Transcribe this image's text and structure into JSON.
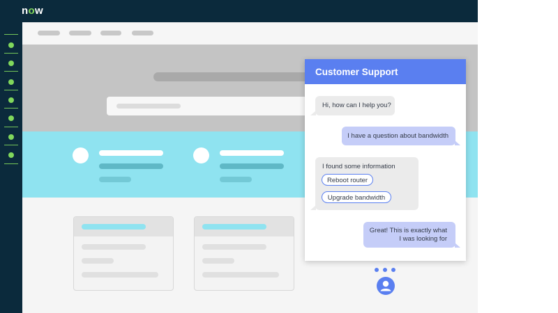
{
  "brand": {
    "logo_text_before": "n",
    "logo_text_o": "o",
    "logo_text_after": "w"
  },
  "colors": {
    "nav_bg": "#0b2a3c",
    "accent_green": "#81d85c",
    "hero_bg": "#c4c4c4",
    "band_bg": "#8fe3f0",
    "chat_primary": "#5a7ff0",
    "bot_bubble": "#ebebeb",
    "user_bubble": "#c5cdf8"
  },
  "sidebar": {
    "items": [
      "nav-item-1",
      "nav-item-2",
      "nav-item-3",
      "nav-item-4",
      "nav-item-5",
      "nav-item-6",
      "nav-item-7"
    ]
  },
  "chat": {
    "title": "Customer Support",
    "messages": [
      {
        "from": "bot",
        "text": "Hi, how can I help you?"
      },
      {
        "from": "user",
        "text": "I have a question about bandwidth"
      },
      {
        "from": "bot",
        "text": "I found some information"
      },
      {
        "from": "user",
        "text": "Great! This is exactly what I was looking for"
      }
    ],
    "quick_replies": [
      "Reboot router",
      "Upgrade bandwidth"
    ],
    "typing_indicator": "typing",
    "agent_icon": "user-avatar-icon"
  }
}
